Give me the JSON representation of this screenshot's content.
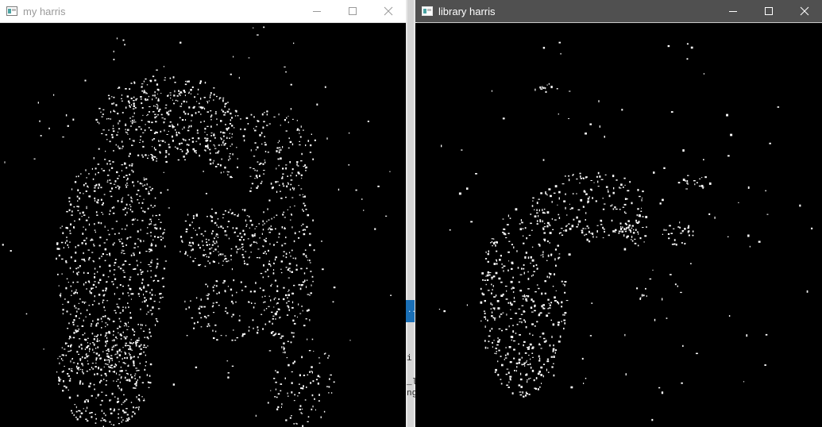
{
  "windows": [
    {
      "title": "my harris",
      "icon": "opencv-window-icon",
      "controls": [
        "minimize-icon",
        "maximize-icon",
        "close-icon"
      ],
      "state": "inactive"
    },
    {
      "title": "library harris",
      "icon": "opencv-window-icon",
      "controls": [
        "minimize-icon",
        "maximize-icon",
        "close-icon"
      ],
      "state": "active"
    }
  ],
  "background_fragments": [
    "i I",
    "_lr",
    "ng"
  ],
  "colors": {
    "inactive_titlebar": "#ffffff",
    "active_titlebar": "#505050",
    "canvas": "#000000",
    "corner_points": "#ffffff"
  }
}
